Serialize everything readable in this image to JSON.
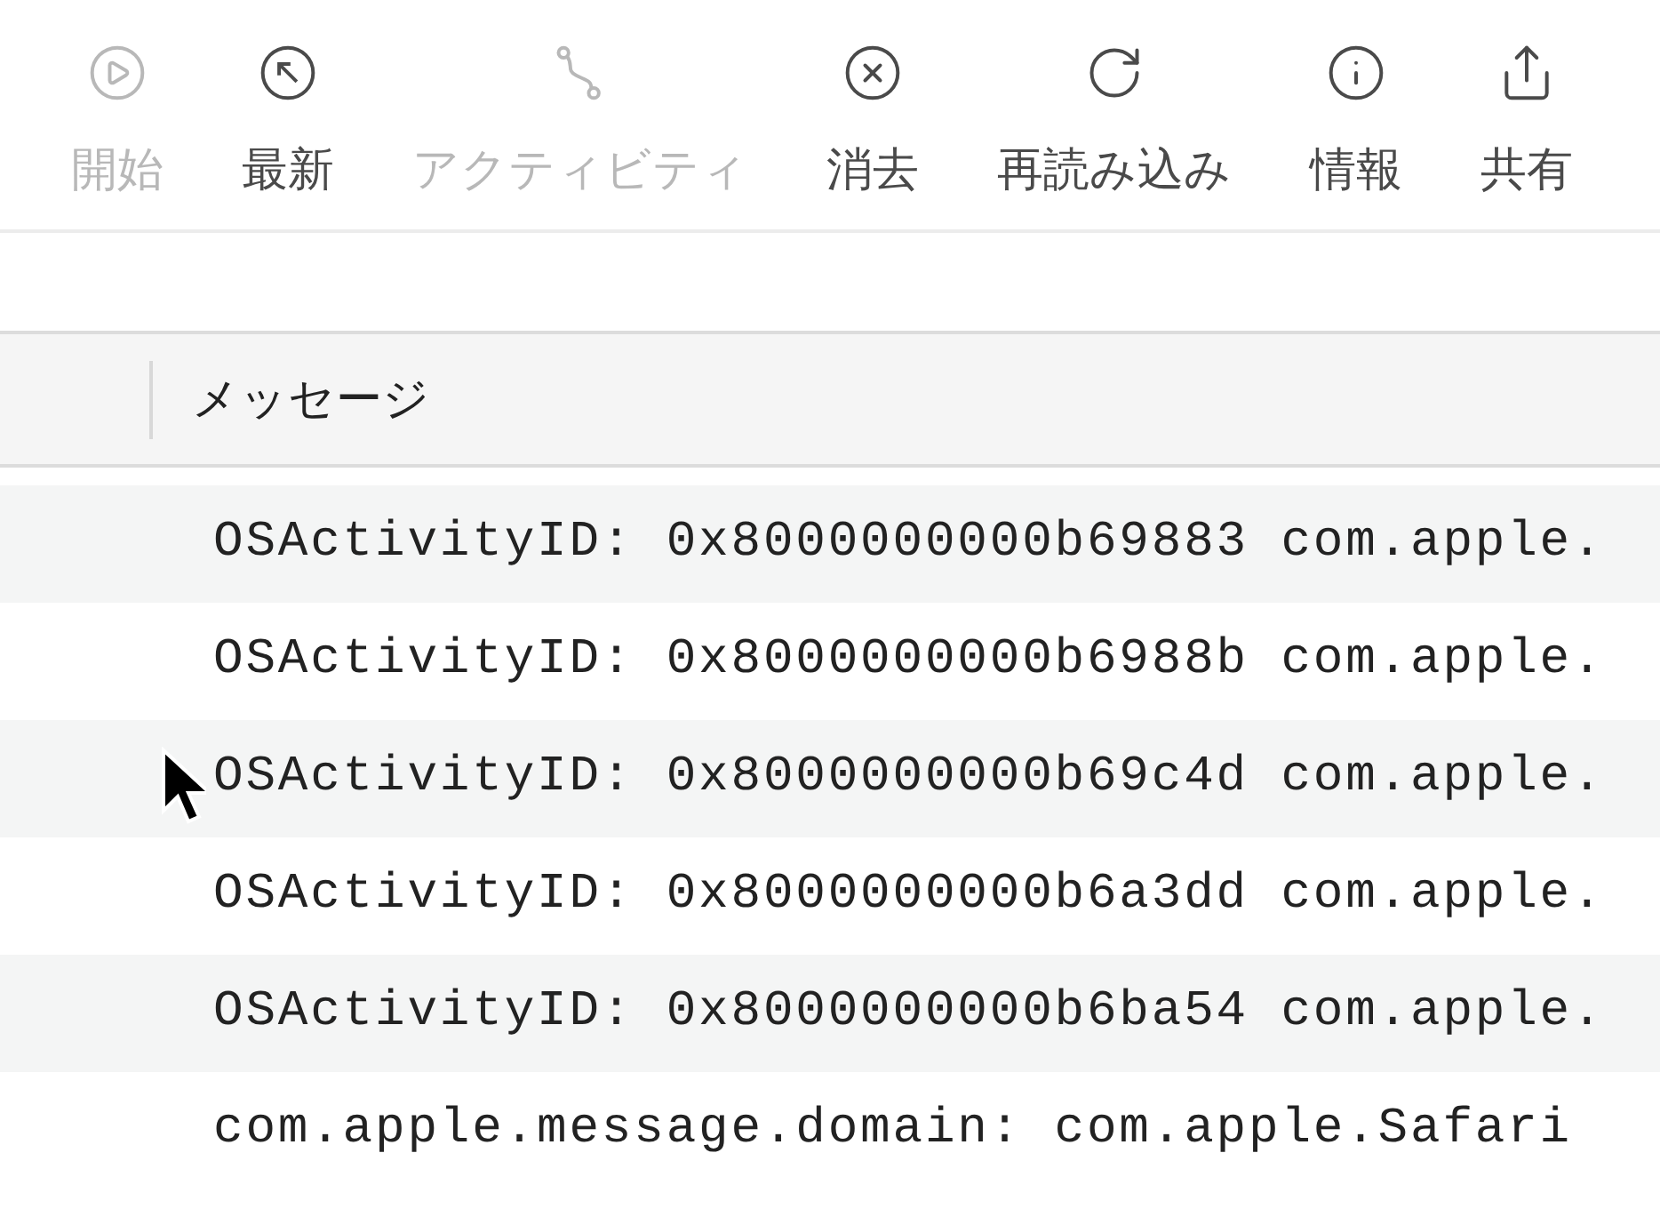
{
  "toolbar": [
    {
      "kind": "play",
      "label": "開始",
      "disabled": true
    },
    {
      "kind": "latest",
      "label": "最新",
      "disabled": false
    },
    {
      "kind": "activity",
      "label": "アクティビティ",
      "disabled": true
    },
    {
      "kind": "clear",
      "label": "消去",
      "disabled": false
    },
    {
      "kind": "reload",
      "label": "再読み込み",
      "disabled": false
    },
    {
      "kind": "info",
      "label": "情報",
      "disabled": false
    },
    {
      "kind": "share",
      "label": "共有",
      "disabled": false
    }
  ],
  "table": {
    "columns": [
      "メッセージ"
    ],
    "rows": [
      "OSActivityID: 0x8000000000b69883 com.apple.",
      "OSActivityID: 0x8000000000b6988b com.apple.",
      "OSActivityID: 0x8000000000b69c4d com.apple.",
      "OSActivityID: 0x8000000000b6a3dd com.apple.",
      "OSActivityID: 0x8000000000b6ba54 com.apple.",
      "com.apple.message.domain: com.apple.Safari"
    ]
  }
}
